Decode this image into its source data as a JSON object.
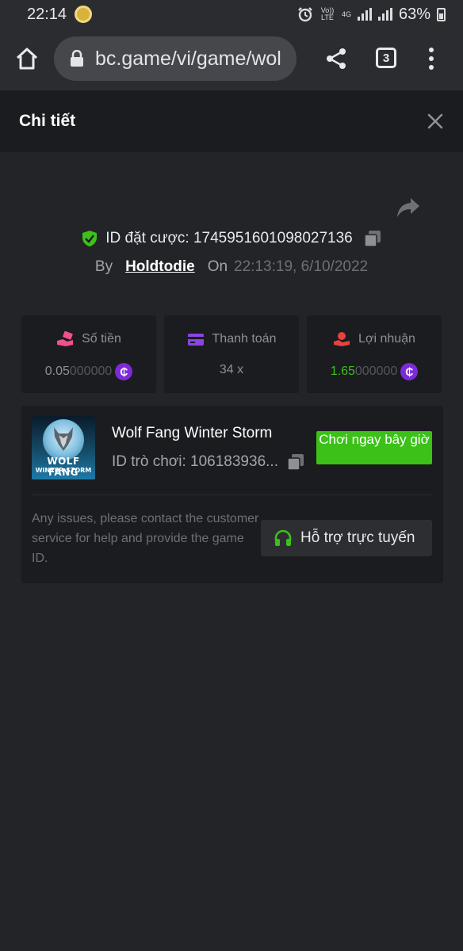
{
  "status_bar": {
    "time": "22:14",
    "volte_label": "Vo)) LTE",
    "network_label": "4G",
    "battery": "63%"
  },
  "browser": {
    "url": "bc.game/vi/game/wol",
    "tab_count": "3"
  },
  "header": {
    "title": "Chi tiết"
  },
  "bet": {
    "id_text": "ID đặt cược: 1745951601098027136",
    "by_label": "By",
    "username": "Holdtodie",
    "on_label": "On",
    "datetime": "22:13:19, 6/10/2022"
  },
  "stats": {
    "amount": {
      "label": "Số tiền",
      "value_main": "0.05",
      "value_dim": "000000"
    },
    "payout": {
      "label": "Thanh toán",
      "value": "34 x"
    },
    "profit": {
      "label": "Lợi nhuận",
      "value_main": "1.65",
      "value_dim": "000000"
    },
    "coin_symbol": "₵"
  },
  "game": {
    "thumb_text_1": "WOLF FANG",
    "thumb_text_2": "WINTER STORM",
    "title": "Wolf Fang Winter Storm",
    "id_text": "ID trò chơi: 106183936...",
    "play_label": "Chơi ngay bây giờ",
    "issue_text": "Any issues, please contact the customer service for help and provide the game ID.",
    "support_label": "Hỗ trợ trực tuyến"
  },
  "colors": {
    "accent_green": "#3bc117",
    "coin_purple": "#7d2bd8",
    "background": "#232428",
    "card": "#1b1c1f"
  },
  "icons": [
    "home-icon",
    "lock-icon",
    "share-icon",
    "tabs-icon",
    "more-menu-icon",
    "close-icon",
    "forward-share-icon",
    "shield-check-icon",
    "copy-icon",
    "money-hand-icon",
    "card-icon",
    "profit-hand-icon",
    "coin-icon",
    "headset-icon"
  ]
}
